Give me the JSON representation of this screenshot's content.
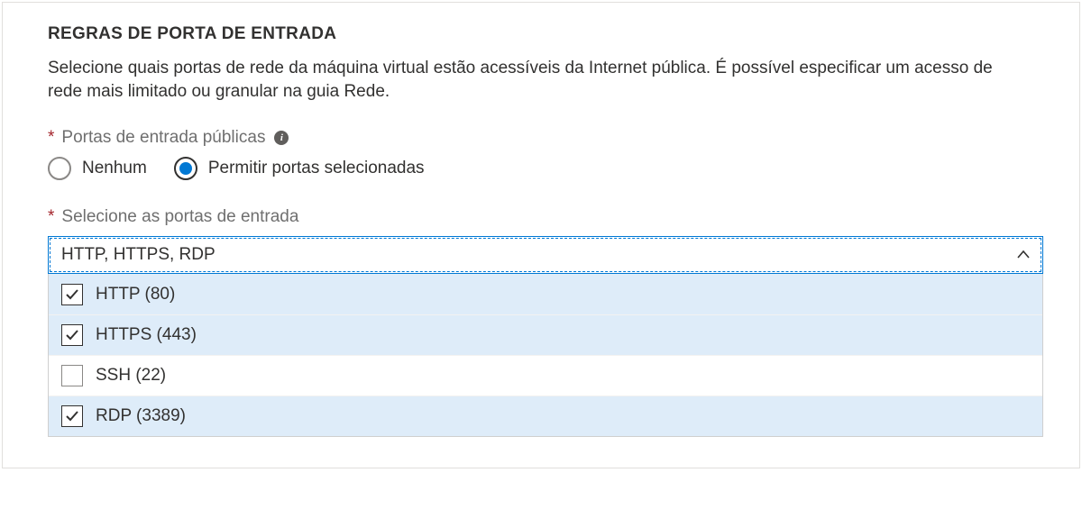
{
  "section": {
    "title": "REGRAS DE PORTA DE ENTRADA",
    "description": "Selecione quais portas de rede da máquina virtual estão acessíveis da Internet pública. É possível especificar um acesso de rede mais limitado ou granular na guia Rede."
  },
  "publicPorts": {
    "label": "Portas de entrada públicas",
    "options": {
      "none": {
        "label": "Nenhum",
        "checked": false
      },
      "allow": {
        "label": "Permitir portas selecionadas",
        "checked": true
      }
    }
  },
  "selectPorts": {
    "label": "Selecione as portas de entrada",
    "value": "HTTP, HTTPS, RDP",
    "options": [
      {
        "label": "HTTP (80)",
        "checked": true
      },
      {
        "label": "HTTPS (443)",
        "checked": true
      },
      {
        "label": "SSH (22)",
        "checked": false
      },
      {
        "label": "RDP (3389)",
        "checked": true
      }
    ]
  }
}
